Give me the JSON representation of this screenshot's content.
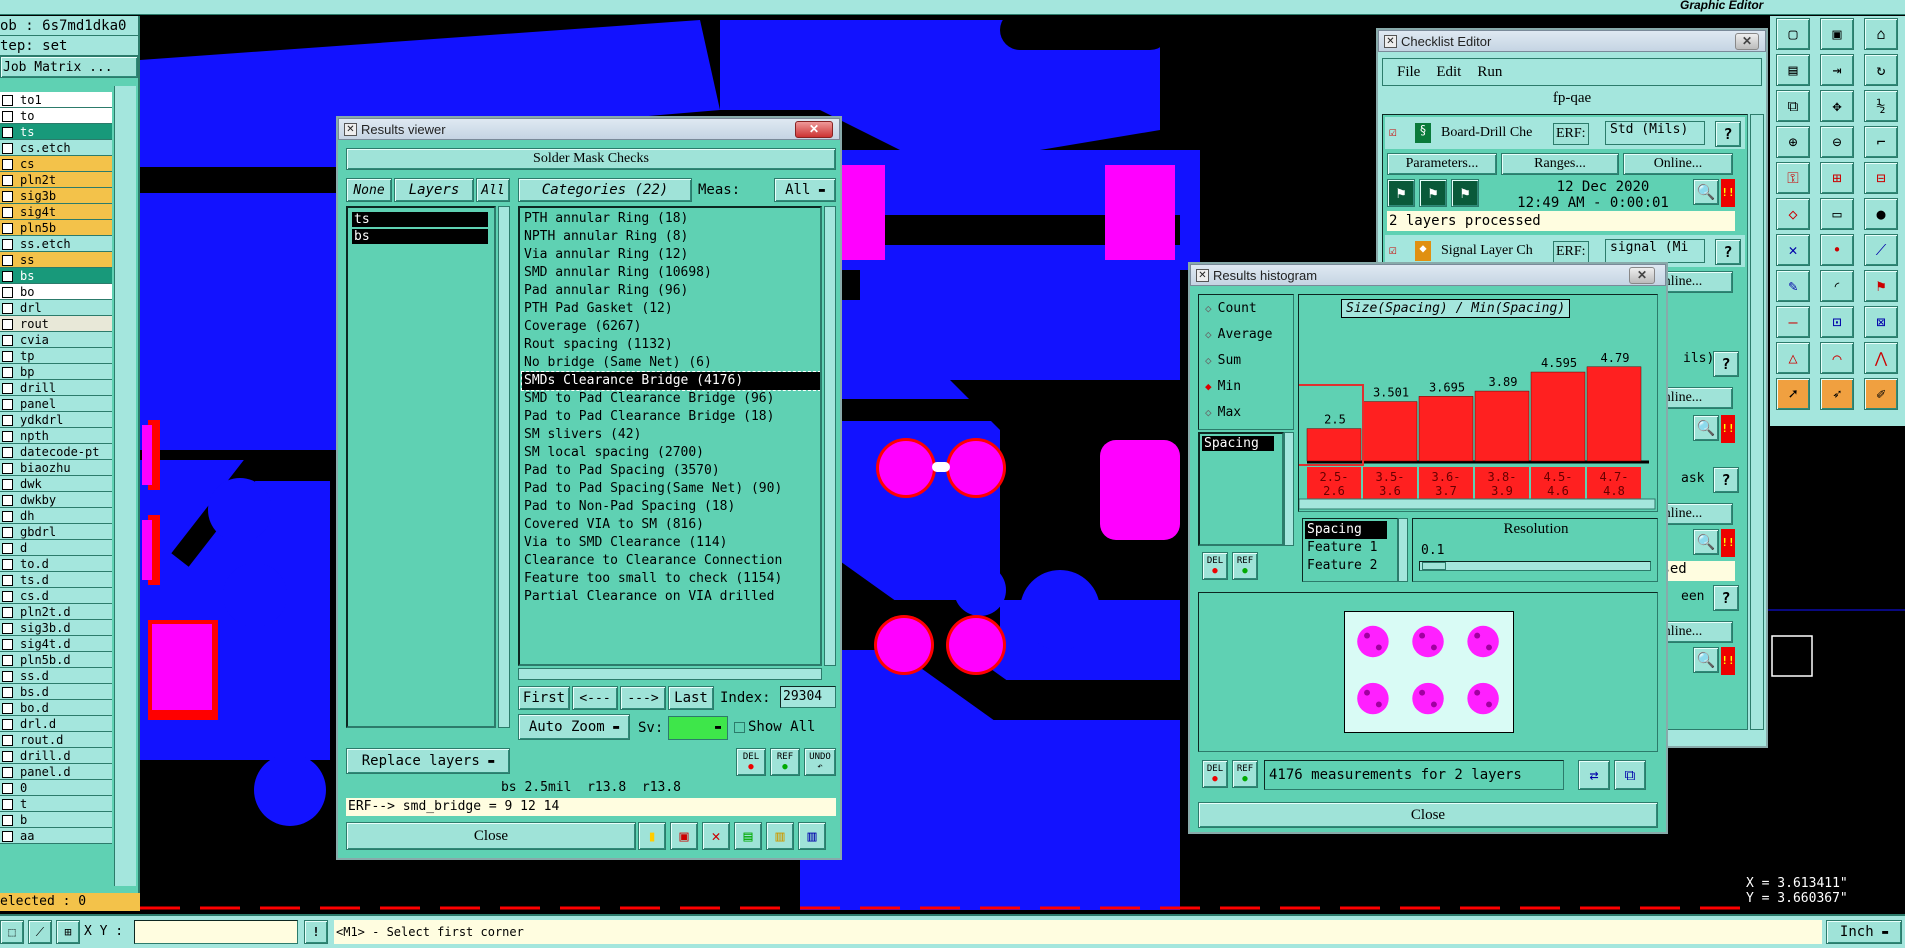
{
  "topbar": {
    "app_title": "Graphic Editor"
  },
  "job_panel": {
    "job": "ob : 6s7md1dka0",
    "step": "tep: set",
    "matrix_button": "Job Matrix ...",
    "layers": [
      {
        "name": "to1",
        "color": "#ffffff",
        "sel": false
      },
      {
        "name": "to",
        "color": "#ffffff",
        "sel": false
      },
      {
        "name": "ts",
        "color": "#18997a",
        "sel": true
      },
      {
        "name": "cs.etch",
        "color": "#a4e6dd",
        "sel": false
      },
      {
        "name": "cs",
        "color": "#f3c24a",
        "sel": false
      },
      {
        "name": "pln2t",
        "color": "#f3c24a",
        "sel": false
      },
      {
        "name": "sig3b",
        "color": "#f3c24a",
        "sel": false
      },
      {
        "name": "sig4t",
        "color": "#f3c24a",
        "sel": false
      },
      {
        "name": "pln5b",
        "color": "#f3c24a",
        "sel": false
      },
      {
        "name": "ss.etch",
        "color": "#a4e6dd",
        "sel": false
      },
      {
        "name": "ss",
        "color": "#f3c24a",
        "sel": false
      },
      {
        "name": "bs",
        "color": "#18997a",
        "sel": true
      },
      {
        "name": "bo",
        "color": "#ffffff",
        "sel": false
      },
      {
        "name": "drl",
        "color": "#a4e6dd",
        "sel": false
      },
      {
        "name": "rout",
        "color": "#e8e8d8",
        "sel": false
      },
      {
        "name": "cvia",
        "color": "#a4e6dd",
        "sel": false
      },
      {
        "name": "tp",
        "color": "#a4e6dd",
        "sel": false
      },
      {
        "name": "bp",
        "color": "#a4e6dd",
        "sel": false
      },
      {
        "name": "drill",
        "color": "#a4e6dd",
        "sel": false
      },
      {
        "name": "panel",
        "color": "#a4e6dd",
        "sel": false
      },
      {
        "name": "ydkdrl",
        "color": "#a4e6dd",
        "sel": false
      },
      {
        "name": "npth",
        "color": "#a4e6dd",
        "sel": false
      },
      {
        "name": "datecode-pt",
        "color": "#a4e6dd",
        "sel": false
      },
      {
        "name": "biaozhu",
        "color": "#a4e6dd",
        "sel": false
      },
      {
        "name": "dwk",
        "color": "#a4e6dd",
        "sel": false
      },
      {
        "name": "dwkby",
        "color": "#a4e6dd",
        "sel": false
      },
      {
        "name": "dh",
        "color": "#a4e6dd",
        "sel": false
      },
      {
        "name": "gbdrl",
        "color": "#a4e6dd",
        "sel": false
      },
      {
        "name": "d",
        "color": "#a4e6dd",
        "sel": false
      },
      {
        "name": "to.d",
        "color": "#a4e6dd",
        "sel": false
      },
      {
        "name": "ts.d",
        "color": "#a4e6dd",
        "sel": false
      },
      {
        "name": "cs.d",
        "color": "#a4e6dd",
        "sel": false
      },
      {
        "name": "pln2t.d",
        "color": "#a4e6dd",
        "sel": false
      },
      {
        "name": "sig3b.d",
        "color": "#a4e6dd",
        "sel": false
      },
      {
        "name": "sig4t.d",
        "color": "#a4e6dd",
        "sel": false
      },
      {
        "name": "pln5b.d",
        "color": "#a4e6dd",
        "sel": false
      },
      {
        "name": "ss.d",
        "color": "#a4e6dd",
        "sel": false
      },
      {
        "name": "bs.d",
        "color": "#a4e6dd",
        "sel": false
      },
      {
        "name": "bo.d",
        "color": "#a4e6dd",
        "sel": false
      },
      {
        "name": "drl.d",
        "color": "#a4e6dd",
        "sel": false
      },
      {
        "name": "rout.d",
        "color": "#a4e6dd",
        "sel": false
      },
      {
        "name": "drill.d",
        "color": "#a4e6dd",
        "sel": false
      },
      {
        "name": "panel.d",
        "color": "#a4e6dd",
        "sel": false
      },
      {
        "name": "0",
        "color": "#a4e6dd",
        "sel": false
      },
      {
        "name": "t",
        "color": "#a4e6dd",
        "sel": false
      },
      {
        "name": "b",
        "color": "#a4e6dd",
        "sel": false
      },
      {
        "name": "aa",
        "color": "#a4e6dd",
        "sel": false
      }
    ],
    "selected": "elected : 0"
  },
  "results_viewer": {
    "window_title": "Results viewer",
    "header": "Solder Mask Checks",
    "none_btn": "None",
    "layers_btn": "Layers",
    "all_btn": "All",
    "layers": [
      "ts",
      "bs"
    ],
    "categories_btn": "Categories (22)",
    "meas_label": "Meas:",
    "meas_value": "All",
    "categories": [
      "PTH annular Ring (18)",
      "NPTH annular Ring (8)",
      "Via annular Ring (12)",
      "SMD annular Ring (10698)",
      "Pad annular Ring (96)",
      "PTH Pad Gasket (12)",
      "Coverage (6267)",
      "Rout spacing (1132)",
      "No bridge (Same Net) (6)",
      "SMDs Clearance Bridge (4176)",
      "SMD to Pad Clearance Bridge (96)",
      "Pad to Pad Clearance Bridge (18)",
      "SM slivers (42)",
      "SM local spacing (2700)",
      "Pad to Pad Spacing (3570)",
      "Pad to Pad Spacing(Same Net) (90)",
      "Pad to Non-Pad Spacing (18)",
      "Covered VIA to SM (816)",
      "Via to SMD Clearance (114)",
      "Clearance to Clearance Connection",
      "Feature too small to check (1154)",
      "Partial Clearance on VIA drilled"
    ],
    "selected_index": 9,
    "first_btn": "First",
    "prev_btn": "<---",
    "next_btn": "--->",
    "last_btn": "Last",
    "index_label": "Index:",
    "index_value": "29304",
    "auto_zoom": "Auto Zoom",
    "sv_label": "Sv:",
    "show_all": "Show All",
    "replace_layers": "Replace layers",
    "del": "DEL",
    "ref": "REF",
    "undo": "UNDO",
    "status": "bs 2.5mil  r13.8  r13.8",
    "erf": "ERF--> smd_bridge = 9 12 14",
    "close": "Close"
  },
  "histogram": {
    "window_title": "Results histogram",
    "options": [
      "Count",
      "Average",
      "Sum",
      "Min",
      "Max"
    ],
    "selected_option": "Min",
    "list_items": [
      "Spacing"
    ],
    "chart_title": "Size(Spacing) / Min(Spacing)",
    "del": "DEL",
    "ref": "REF",
    "features": [
      "Spacing",
      "Feature 1",
      "Feature 2"
    ],
    "resolution_label": "Resolution",
    "resolution_value": "0.1",
    "footer": "4176 measurements for 2 layers",
    "close": "Close"
  },
  "chart_data": {
    "type": "bar",
    "title": "Size(Spacing) / Min(Spacing)",
    "categories": [
      "2.5-\n2.6",
      "3.5-\n3.6",
      "3.6-\n3.7",
      "3.8-\n3.9",
      "4.5-\n4.6",
      "4.7-\n4.8"
    ],
    "values": [
      2.5,
      3.501,
      3.695,
      3.89,
      4.595,
      4.79
    ],
    "value_labels": [
      "2.5",
      "3.501",
      "3.695",
      "3.89",
      "4.595",
      "4.79"
    ],
    "bar_color": "#ff2020"
  },
  "checklist": {
    "window_title": "Checklist Editor",
    "menu": [
      "File",
      "Edit",
      "Run"
    ],
    "name": "fp-qae",
    "items": [
      {
        "name": "Board-Drill Che",
        "erf": "Std (Mils)",
        "date": "12 Dec 2020",
        "time": "12:49 AM - 0:00:01",
        "status": "2 layers processed"
      },
      {
        "name": "Signal Layer Ch",
        "erf": "signal (Mi"
      }
    ],
    "parameters": "Parameters...",
    "ranges": "Ranges...",
    "online": "Online...",
    "erf_label": "ERF:",
    "help": "?",
    "frag_mils": "ils)",
    "frag_ask": "ask",
    "frag_ssed": "ssed",
    "frag_een": "een"
  },
  "coords": {
    "x": "X = 3.613411\"",
    "y": "Y = 3.660367\""
  },
  "statusbar": {
    "xy_label": "X Y :",
    "xy_value": "",
    "prompt": "<M1> - Select first corner",
    "units": "Inch"
  }
}
